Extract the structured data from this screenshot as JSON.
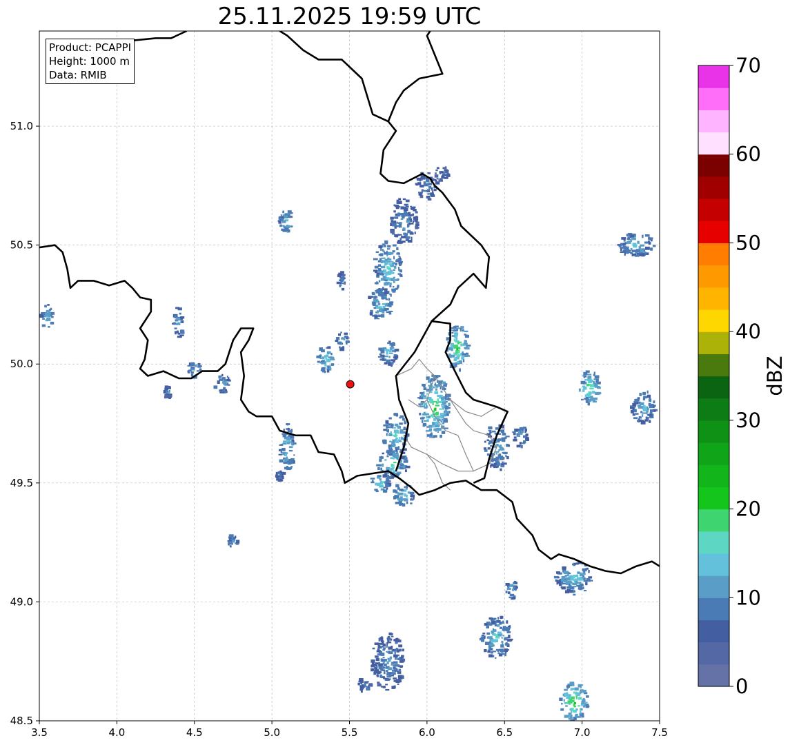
{
  "title": "25.11.2025 19:59 UTC",
  "info": {
    "product": "Product: PCAPPI",
    "height": "Height: 1000 m",
    "data": "Data: RMIB"
  },
  "chart_data": {
    "type": "heatmap",
    "title": "25.11.2025 19:59 UTC",
    "xlim": [
      3.5,
      7.5
    ],
    "ylim": [
      48.5,
      51.4
    ],
    "x_ticks": [
      "3.5",
      "4.0",
      "4.5",
      "5.0",
      "5.5",
      "6.0",
      "6.5",
      "7.0",
      "7.5"
    ],
    "y_ticks": [
      "48.5",
      "49.0",
      "49.5",
      "50.0",
      "50.5",
      "51.0"
    ],
    "grid": true,
    "radar_site": {
      "lon": 5.505,
      "lat": 49.915,
      "color": "#ee1111"
    },
    "colorbar": {
      "label": "dBZ",
      "min": 0,
      "max": 70,
      "tick_labels": [
        "0",
        "10",
        "20",
        "30",
        "40",
        "50",
        "60",
        "70"
      ],
      "colors": [
        "#6472a8",
        "#5568a6",
        "#445ea2",
        "#4b7bb4",
        "#5a9ec8",
        "#64c1dc",
        "#5ed6c4",
        "#3ed470",
        "#14c61c",
        "#12b51a",
        "#10a418",
        "#0f9116",
        "#0e7c14",
        "#0b6412",
        "#4a7a0e",
        "#adb209",
        "#ffd700",
        "#ffb400",
        "#ff9900",
        "#ff7d00",
        "#e60000",
        "#c40000",
        "#a00000",
        "#7b0000",
        "#ffe0ff",
        "#ffb4ff",
        "#ff6ef8",
        "#e933e9"
      ]
    },
    "echoes": [
      {
        "lon": 5.1,
        "lat": 50.6,
        "rx": 0.05,
        "ry": 0.05,
        "dbz": 8,
        "core": 14
      },
      {
        "lon": 5.85,
        "lat": 50.6,
        "rx": 0.09,
        "ry": 0.1,
        "dbz": 6,
        "core": 12
      },
      {
        "lon": 6.0,
        "lat": 50.75,
        "rx": 0.07,
        "ry": 0.06,
        "dbz": 5,
        "core": 10
      },
      {
        "lon": 6.1,
        "lat": 50.8,
        "rx": 0.05,
        "ry": 0.03,
        "dbz": 5,
        "core": 9
      },
      {
        "lon": 5.75,
        "lat": 50.4,
        "rx": 0.09,
        "ry": 0.12,
        "dbz": 8,
        "core": 16
      },
      {
        "lon": 5.7,
        "lat": 50.25,
        "rx": 0.08,
        "ry": 0.07,
        "dbz": 8,
        "core": 15
      },
      {
        "lon": 5.45,
        "lat": 50.35,
        "rx": 0.02,
        "ry": 0.04,
        "dbz": 6,
        "core": 10
      },
      {
        "lon": 3.55,
        "lat": 50.2,
        "rx": 0.04,
        "ry": 0.05,
        "dbz": 8,
        "core": 14
      },
      {
        "lon": 4.4,
        "lat": 50.17,
        "rx": 0.03,
        "ry": 0.07,
        "dbz": 7,
        "core": 12
      },
      {
        "lon": 4.5,
        "lat": 49.98,
        "rx": 0.04,
        "ry": 0.04,
        "dbz": 7,
        "core": 13
      },
      {
        "lon": 4.68,
        "lat": 49.92,
        "rx": 0.05,
        "ry": 0.04,
        "dbz": 7,
        "core": 12
      },
      {
        "lon": 4.33,
        "lat": 49.88,
        "rx": 0.02,
        "ry": 0.03,
        "dbz": 6,
        "core": 10
      },
      {
        "lon": 5.1,
        "lat": 49.65,
        "rx": 0.05,
        "ry": 0.1,
        "dbz": 8,
        "core": 16
      },
      {
        "lon": 5.05,
        "lat": 49.53,
        "rx": 0.03,
        "ry": 0.02,
        "dbz": 6,
        "core": 9
      },
      {
        "lon": 5.35,
        "lat": 50.02,
        "rx": 0.05,
        "ry": 0.06,
        "dbz": 8,
        "core": 18
      },
      {
        "lon": 5.45,
        "lat": 50.1,
        "rx": 0.04,
        "ry": 0.04,
        "dbz": 7,
        "core": 14
      },
      {
        "lon": 5.75,
        "lat": 50.05,
        "rx": 0.06,
        "ry": 0.06,
        "dbz": 7,
        "core": 16
      },
      {
        "lon": 6.2,
        "lat": 50.07,
        "rx": 0.07,
        "ry": 0.1,
        "dbz": 9,
        "core": 22
      },
      {
        "lon": 6.05,
        "lat": 49.82,
        "rx": 0.1,
        "ry": 0.14,
        "dbz": 9,
        "core": 22
      },
      {
        "lon": 5.8,
        "lat": 49.7,
        "rx": 0.08,
        "ry": 0.09,
        "dbz": 8,
        "core": 17
      },
      {
        "lon": 5.78,
        "lat": 49.58,
        "rx": 0.1,
        "ry": 0.06,
        "dbz": 8,
        "core": 20
      },
      {
        "lon": 5.7,
        "lat": 49.5,
        "rx": 0.06,
        "ry": 0.04,
        "dbz": 8,
        "core": 18
      },
      {
        "lon": 5.85,
        "lat": 49.45,
        "rx": 0.07,
        "ry": 0.05,
        "dbz": 8,
        "core": 16
      },
      {
        "lon": 6.45,
        "lat": 49.65,
        "rx": 0.08,
        "ry": 0.1,
        "dbz": 7,
        "core": 13
      },
      {
        "lon": 6.6,
        "lat": 49.7,
        "rx": 0.05,
        "ry": 0.05,
        "dbz": 7,
        "core": 12
      },
      {
        "lon": 7.35,
        "lat": 50.5,
        "rx": 0.12,
        "ry": 0.05,
        "dbz": 7,
        "core": 16
      },
      {
        "lon": 7.05,
        "lat": 49.9,
        "rx": 0.07,
        "ry": 0.07,
        "dbz": 9,
        "core": 22
      },
      {
        "lon": 7.4,
        "lat": 49.82,
        "rx": 0.08,
        "ry": 0.07,
        "dbz": 7,
        "core": 14
      },
      {
        "lon": 4.75,
        "lat": 49.25,
        "rx": 0.03,
        "ry": 0.03,
        "dbz": 7,
        "core": 12
      },
      {
        "lon": 6.95,
        "lat": 49.1,
        "rx": 0.12,
        "ry": 0.07,
        "dbz": 7,
        "core": 16
      },
      {
        "lon": 6.55,
        "lat": 49.05,
        "rx": 0.04,
        "ry": 0.04,
        "dbz": 7,
        "core": 13
      },
      {
        "lon": 6.45,
        "lat": 48.85,
        "rx": 0.1,
        "ry": 0.09,
        "dbz": 7,
        "core": 16
      },
      {
        "lon": 5.75,
        "lat": 48.75,
        "rx": 0.11,
        "ry": 0.12,
        "dbz": 6,
        "core": 12
      },
      {
        "lon": 5.6,
        "lat": 48.65,
        "rx": 0.04,
        "ry": 0.03,
        "dbz": 6,
        "core": 10
      },
      {
        "lon": 6.95,
        "lat": 48.58,
        "rx": 0.09,
        "ry": 0.08,
        "dbz": 10,
        "core": 24
      }
    ],
    "borders_thick": [
      [
        [
          3.5,
          50.49
        ],
        [
          3.6,
          50.5
        ],
        [
          3.65,
          50.47
        ],
        [
          3.68,
          50.4
        ],
        [
          3.7,
          50.32
        ],
        [
          3.75,
          50.35
        ],
        [
          3.85,
          50.35
        ],
        [
          3.95,
          50.33
        ],
        [
          4.05,
          50.35
        ],
        [
          4.1,
          50.32
        ],
        [
          4.15,
          50.28
        ],
        [
          4.22,
          50.27
        ],
        [
          4.22,
          50.22
        ],
        [
          4.15,
          50.15
        ],
        [
          4.2,
          50.1
        ],
        [
          4.18,
          50.02
        ],
        [
          4.15,
          49.98
        ],
        [
          4.2,
          49.95
        ],
        [
          4.3,
          49.97
        ],
        [
          4.4,
          49.94
        ],
        [
          4.48,
          49.94
        ],
        [
          4.55,
          49.97
        ],
        [
          4.65,
          49.97
        ],
        [
          4.7,
          50.0
        ],
        [
          4.75,
          50.1
        ],
        [
          4.8,
          50.15
        ],
        [
          4.88,
          50.15
        ],
        [
          4.85,
          50.1
        ],
        [
          4.8,
          50.05
        ],
        [
          4.82,
          49.95
        ],
        [
          4.8,
          49.85
        ],
        [
          4.85,
          49.8
        ],
        [
          4.9,
          49.78
        ],
        [
          5.0,
          49.78
        ],
        [
          5.05,
          49.72
        ],
        [
          5.15,
          49.7
        ],
        [
          5.25,
          49.7
        ],
        [
          5.3,
          49.63
        ],
        [
          5.4,
          49.62
        ],
        [
          5.45,
          49.55
        ],
        [
          5.47,
          49.5
        ],
        [
          5.55,
          49.53
        ],
        [
          5.65,
          49.54
        ],
        [
          5.75,
          49.55
        ],
        [
          5.82,
          49.52
        ],
        [
          5.9,
          49.48
        ],
        [
          5.95,
          49.45
        ],
        [
          6.05,
          49.47
        ],
        [
          6.15,
          49.5
        ],
        [
          6.25,
          49.51
        ],
        [
          6.35,
          49.47
        ],
        [
          6.45,
          49.47
        ],
        [
          6.55,
          49.42
        ],
        [
          6.58,
          49.35
        ],
        [
          6.68,
          49.28
        ],
        [
          6.72,
          49.22
        ],
        [
          6.8,
          49.18
        ],
        [
          6.85,
          49.2
        ],
        [
          6.95,
          49.18
        ],
        [
          7.05,
          49.15
        ],
        [
          7.15,
          49.13
        ],
        [
          7.25,
          49.12
        ],
        [
          7.35,
          49.15
        ],
        [
          7.45,
          49.17
        ],
        [
          7.5,
          49.15
        ]
      ],
      [
        [
          5.8,
          49.55
        ],
        [
          5.85,
          49.65
        ],
        [
          5.88,
          49.75
        ],
        [
          5.82,
          49.85
        ],
        [
          5.8,
          49.95
        ],
        [
          5.92,
          50.05
        ],
        [
          6.03,
          50.18
        ],
        [
          6.15,
          50.17
        ],
        [
          6.15,
          50.1
        ],
        [
          6.12,
          50.05
        ],
        [
          6.18,
          49.97
        ],
        [
          6.25,
          49.88
        ],
        [
          6.3,
          49.85
        ],
        [
          6.45,
          49.82
        ],
        [
          6.52,
          49.8
        ],
        [
          6.45,
          49.7
        ],
        [
          6.4,
          49.6
        ],
        [
          6.37,
          49.52
        ],
        [
          6.3,
          49.5
        ]
      ],
      [
        [
          6.03,
          50.18
        ],
        [
          6.15,
          50.25
        ],
        [
          6.2,
          50.32
        ],
        [
          6.3,
          50.38
        ],
        [
          6.38,
          50.32
        ],
        [
          6.4,
          50.45
        ],
        [
          6.35,
          50.5
        ],
        [
          6.22,
          50.58
        ],
        [
          6.18,
          50.65
        ],
        [
          6.1,
          50.72
        ],
        [
          6.05,
          50.75
        ],
        [
          6.02,
          50.78
        ],
        [
          5.97,
          50.8
        ],
        [
          5.85,
          50.76
        ],
        [
          5.75,
          50.77
        ],
        [
          5.7,
          50.8
        ],
        [
          5.72,
          50.9
        ],
        [
          5.8,
          50.98
        ],
        [
          5.75,
          51.02
        ],
        [
          5.8,
          51.1
        ],
        [
          5.85,
          51.15
        ],
        [
          5.95,
          51.2
        ],
        [
          6.1,
          51.22
        ],
        [
          6.05,
          51.3
        ],
        [
          6.0,
          51.38
        ],
        [
          6.02,
          51.4
        ]
      ],
      [
        [
          5.75,
          51.02
        ],
        [
          5.65,
          51.05
        ],
        [
          5.58,
          51.2
        ],
        [
          5.45,
          51.28
        ],
        [
          5.3,
          51.28
        ],
        [
          5.2,
          51.32
        ],
        [
          5.1,
          51.38
        ],
        [
          5.05,
          51.4
        ]
      ],
      [
        [
          4.45,
          51.4
        ],
        [
          4.35,
          51.37
        ],
        [
          4.25,
          51.37
        ],
        [
          4.1,
          51.36
        ],
        [
          3.95,
          51.33
        ],
        [
          3.8,
          51.3
        ],
        [
          3.7,
          51.28
        ],
        [
          3.6,
          51.3
        ],
        [
          3.55,
          51.33
        ]
      ]
    ],
    "borders_thin": [
      [
        [
          5.8,
          49.95
        ],
        [
          5.9,
          49.98
        ],
        [
          5.95,
          50.02
        ],
        [
          6.0,
          49.98
        ],
        [
          6.05,
          49.95
        ],
        [
          6.1,
          49.9
        ],
        [
          6.15,
          49.85
        ],
        [
          6.2,
          49.8
        ],
        [
          6.25,
          49.75
        ],
        [
          6.3,
          49.72
        ],
        [
          6.4,
          49.7
        ],
        [
          6.45,
          49.65
        ],
        [
          6.4,
          49.58
        ],
        [
          6.3,
          49.55
        ],
        [
          6.2,
          49.55
        ],
        [
          6.1,
          49.58
        ],
        [
          6.0,
          49.62
        ],
        [
          5.9,
          49.65
        ],
        [
          5.85,
          49.7
        ]
      ],
      [
        [
          6.05,
          49.95
        ],
        [
          6.0,
          49.85
        ],
        [
          6.05,
          49.78
        ],
        [
          6.12,
          49.72
        ],
        [
          6.2,
          49.7
        ],
        [
          6.25,
          49.62
        ],
        [
          6.3,
          49.55
        ]
      ],
      [
        [
          5.88,
          49.85
        ],
        [
          5.95,
          49.82
        ],
        [
          6.0,
          49.85
        ]
      ],
      [
        [
          6.15,
          49.85
        ],
        [
          6.25,
          49.8
        ],
        [
          6.35,
          49.78
        ],
        [
          6.45,
          49.82
        ]
      ],
      [
        [
          6.0,
          49.62
        ],
        [
          6.05,
          49.58
        ],
        [
          6.1,
          49.5
        ],
        [
          6.15,
          49.47
        ]
      ]
    ]
  }
}
